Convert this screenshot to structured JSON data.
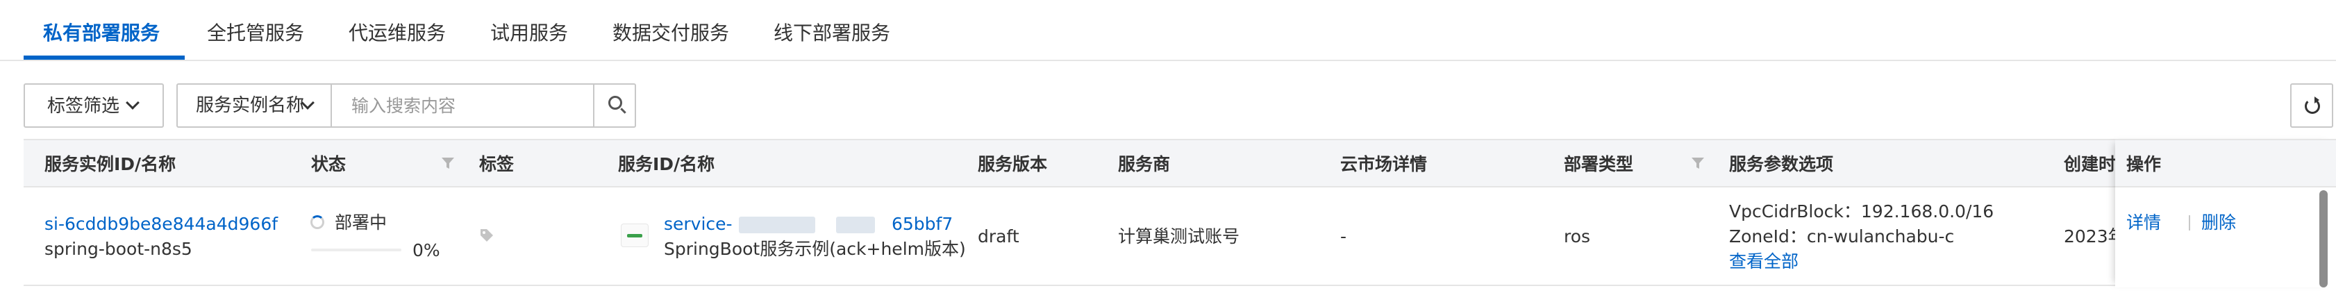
{
  "tabs": [
    {
      "label": "私有部署服务",
      "active": true
    },
    {
      "label": "全托管服务",
      "active": false
    },
    {
      "label": "代运维服务",
      "active": false
    },
    {
      "label": "试用服务",
      "active": false
    },
    {
      "label": "数据交付服务",
      "active": false
    },
    {
      "label": "线下部署服务",
      "active": false
    }
  ],
  "toolbar": {
    "tag_filter_label": "标签筛选",
    "search_field_label": "服务实例名称",
    "search_placeholder": "输入搜索内容",
    "search_value": ""
  },
  "table": {
    "columns": [
      "服务实例ID/名称",
      "状态",
      "标签",
      "服务ID/名称",
      "服务版本",
      "服务商",
      "云市场详情",
      "部署类型",
      "服务参数选项",
      "创建时",
      "操作"
    ],
    "rows": [
      {
        "instance_id": "si-6cddb9be8e844a4d966f",
        "instance_name": "spring-boot-n8s5",
        "status": "部署中",
        "progress_text": "0%",
        "progress": 0,
        "service_id_prefix": "service-",
        "service_id_suffix": "65bbf7",
        "service_name": "SpringBoot服务示例(ack+helm版本)",
        "version": "draft",
        "provider": "计算巢测试账号",
        "market_detail": "-",
        "deploy_type": "ros",
        "param_vpc": "VpcCidrBlock：192.168.0.0/16",
        "param_zone": "ZoneId：cn-wulanchabu-c",
        "param_view_all": "查看全部",
        "created": "2023年",
        "op_detail": "详情",
        "op_delete": "删除"
      }
    ]
  },
  "colors": {
    "accent": "#0064c8",
    "text": "#333333",
    "header_bg": "#f4f5f7",
    "border": "#e5e5e5"
  },
  "icons": [
    "chevron-down-icon",
    "search-icon",
    "refresh-icon",
    "filter-icon",
    "loading-spinner-icon",
    "tag-icon",
    "service-logo-icon"
  ]
}
